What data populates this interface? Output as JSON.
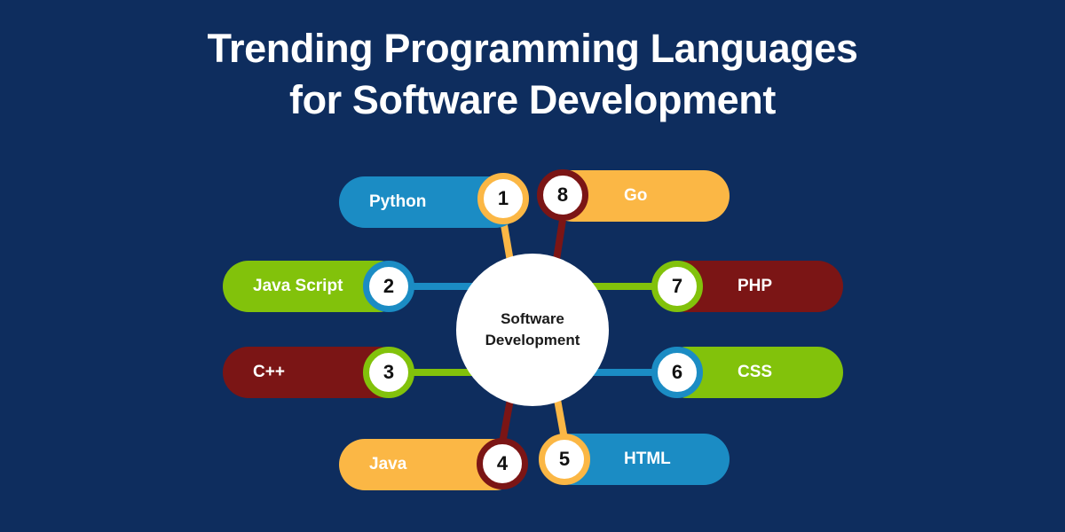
{
  "theme": {
    "background": "#0e2d5e",
    "hub_fill": "#ffffff",
    "blue": "#1b8cc4",
    "green": "#82c20b",
    "orange": "#fbb745",
    "darkred": "#7b1515",
    "title_color": "#ffffff",
    "number_color": "#111111"
  },
  "title": {
    "line1": "Trending Programming Languages",
    "line2": "for Software Development"
  },
  "hub": {
    "line1": "Software",
    "line2": "Development"
  },
  "chart_data": {
    "type": "diagram",
    "title": "Trending Programming Languages for Software Development",
    "center": "Software Development",
    "nodes": [
      {
        "number": "1",
        "label": "Python",
        "side": "left",
        "pill_color": "#1b8cc4",
        "badge_color": "#fbb745",
        "connector_color": "#fbb745",
        "connector": "stem-down"
      },
      {
        "number": "2",
        "label": "Java Script",
        "side": "left",
        "pill_color": "#82c20b",
        "badge_color": "#1b8cc4",
        "connector_color": "#1b8cc4",
        "connector": "line-right"
      },
      {
        "number": "3",
        "label": "C++",
        "side": "left",
        "pill_color": "#7b1515",
        "badge_color": "#82c20b",
        "connector_color": "#82c20b",
        "connector": "line-right"
      },
      {
        "number": "4",
        "label": "Java",
        "side": "left",
        "pill_color": "#fbb745",
        "badge_color": "#7b1515",
        "connector_color": "#7b1515",
        "connector": "stem-up"
      },
      {
        "number": "5",
        "label": "HTML",
        "side": "right",
        "pill_color": "#1b8cc4",
        "badge_color": "#fbb745",
        "connector_color": "#fbb745",
        "connector": "stem-up"
      },
      {
        "number": "6",
        "label": "CSS",
        "side": "right",
        "pill_color": "#82c20b",
        "badge_color": "#1b8cc4",
        "connector_color": "#1b8cc4",
        "connector": "line-left"
      },
      {
        "number": "7",
        "label": "PHP",
        "side": "right",
        "pill_color": "#7b1515",
        "badge_color": "#82c20b",
        "connector_color": "#82c20b",
        "connector": "line-left"
      },
      {
        "number": "8",
        "label": "Go",
        "side": "right",
        "pill_color": "#fbb745",
        "badge_color": "#7b1515",
        "connector_color": "#7b1515",
        "connector": "stem-down"
      }
    ]
  }
}
